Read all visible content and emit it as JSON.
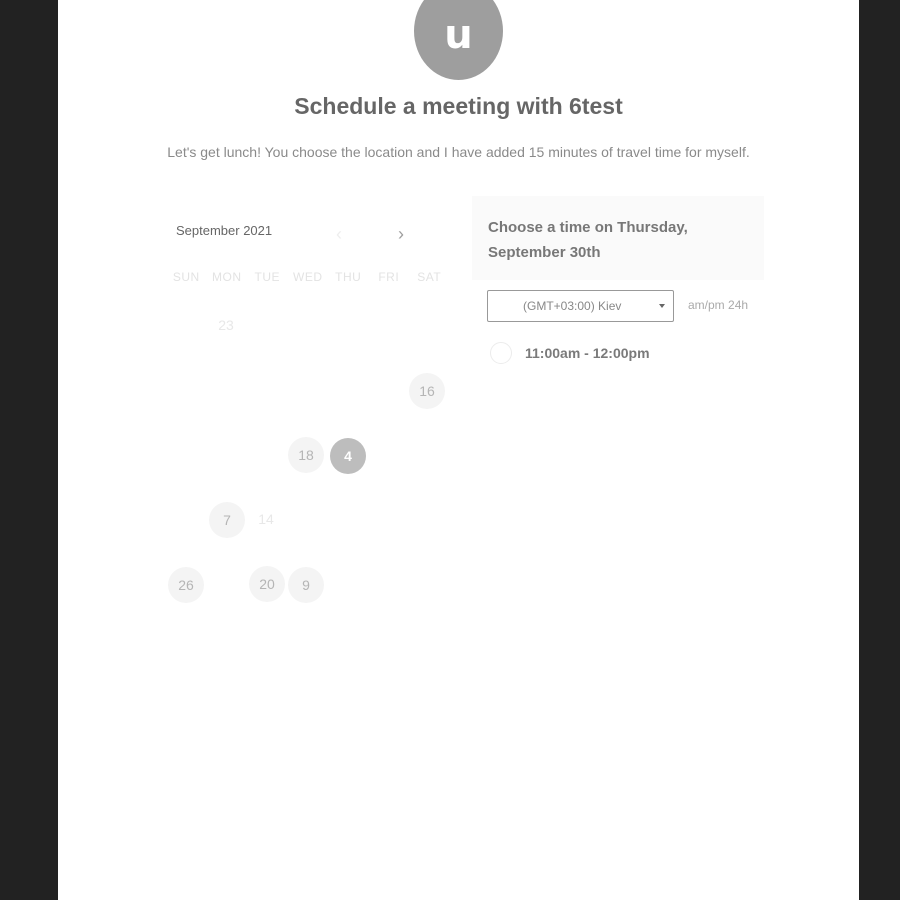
{
  "header": {
    "avatar_letter": "u",
    "title": "Schedule a meeting with 6test",
    "subtitle": "Let's get lunch! You choose the location and I have added 15 minutes of travel time for myself."
  },
  "calendar": {
    "month_label": "September 2021",
    "prev_icon": "chevron-left-icon",
    "next_icon": "chevron-right-icon",
    "prev_glyph": "‹",
    "next_glyph": "›",
    "weekdays": [
      "SUN",
      "MON",
      "TUE",
      "WED",
      "THU",
      "FRI",
      "SAT"
    ],
    "days": [
      {
        "label": "23",
        "state": "faint"
      },
      {
        "label": "16",
        "state": "available"
      },
      {
        "label": "18",
        "state": "available"
      },
      {
        "label": "4",
        "state": "selected"
      },
      {
        "label": "7",
        "state": "available"
      },
      {
        "label": "14",
        "state": "faint"
      },
      {
        "label": "26",
        "state": "available"
      },
      {
        "label": "20",
        "state": "available"
      },
      {
        "label": "9",
        "state": "available"
      }
    ]
  },
  "times": {
    "heading": "Choose a time on Thursday, September 30th",
    "timezone": "(GMT+03:00) Kiev",
    "format_ampm": "am/pm",
    "format_sep": " ",
    "format_24h": "24h",
    "slots": [
      {
        "label": "11:00am - 12:00pm"
      }
    ]
  },
  "colors": {
    "page_bg": "#222222",
    "card_bg": "#ffffff",
    "avatar_bg": "#9e9e9e",
    "selected_day": "#bdbdbd"
  }
}
